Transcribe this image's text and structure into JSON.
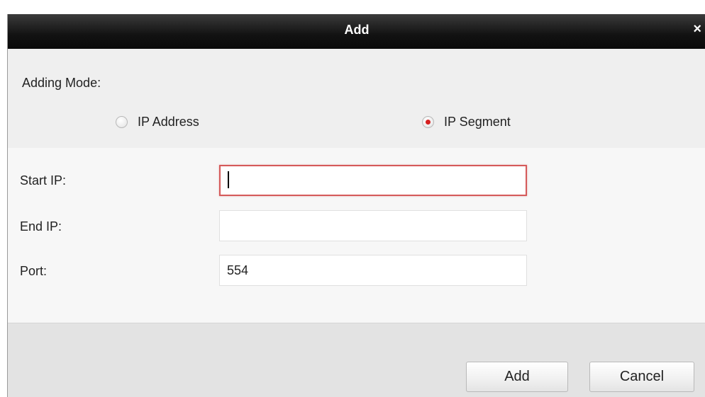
{
  "dialog": {
    "title": "Add",
    "close_glyph": "×"
  },
  "mode": {
    "label": "Adding Mode:",
    "options": [
      {
        "label": "IP Address",
        "checked": false
      },
      {
        "label": "IP Segment",
        "checked": true
      }
    ]
  },
  "fields": {
    "start_ip": {
      "label": "Start IP:",
      "value": ""
    },
    "end_ip": {
      "label": "End IP:",
      "value": ""
    },
    "port": {
      "label": "Port:",
      "value": "554"
    }
  },
  "buttons": {
    "add": "Add",
    "cancel": "Cancel"
  },
  "colors": {
    "accent": "#d62020",
    "focus_border": "#d55a5a",
    "titlebar": "#121212"
  }
}
